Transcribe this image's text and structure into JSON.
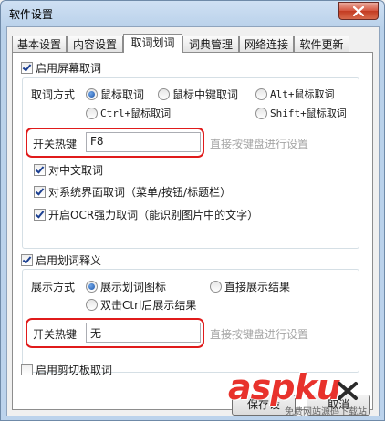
{
  "window": {
    "title": "软件设置"
  },
  "tabs": [
    {
      "label": "基本设置",
      "active": false
    },
    {
      "label": "内容设置",
      "active": false
    },
    {
      "label": "取词划词",
      "active": true
    },
    {
      "label": "词典管理",
      "active": false
    },
    {
      "label": "网络连接",
      "active": false
    },
    {
      "label": "软件更新",
      "active": false
    }
  ],
  "screen_capture": {
    "enable_label": "启用屏幕取词",
    "enabled": true,
    "method_label": "取词方式",
    "methods": [
      {
        "label": "鼠标取词",
        "selected": true
      },
      {
        "label": "鼠标中键取词",
        "selected": false
      },
      {
        "label": "Alt+鼠标取词",
        "selected": false
      },
      {
        "label": "Ctrl+鼠标取词",
        "selected": false
      },
      {
        "label": "Shift+鼠标取词",
        "selected": false
      }
    ],
    "hotkey_label": "开关热键",
    "hotkey_value": "F8",
    "hotkey_hint": "直接按键盘进行设置",
    "options": [
      {
        "label": "对中文取词",
        "checked": true
      },
      {
        "label": "对系统界面取词（菜单/按钮/标题栏）",
        "checked": true
      },
      {
        "label": "开启OCR强力取词（能识别图片中的文字）",
        "checked": true
      }
    ]
  },
  "selection": {
    "enable_label": "启用划词释义",
    "enabled": true,
    "display_label": "展示方式",
    "modes": [
      {
        "label": "展示划词图标",
        "selected": true
      },
      {
        "label": "直接展示结果",
        "selected": false
      },
      {
        "label": "双击Ctrl后展示结果",
        "selected": false
      }
    ],
    "hotkey_label": "开关热键",
    "hotkey_value": "无",
    "hotkey_hint": "直接按键盘进行设置"
  },
  "clipboard": {
    "enable_label": "启用剪切板取词",
    "enabled": false
  },
  "buttons": {
    "save_label": "保存设",
    "cancel_label": "取消"
  },
  "watermark": {
    "main": "aspku",
    "sub": "免费网站源码下载站",
    "icons": [
      "x-icon"
    ]
  },
  "colors": {
    "highlight": "#e01b1b",
    "hint_text": "#a5a5a5",
    "watermark": "#e8322c"
  }
}
